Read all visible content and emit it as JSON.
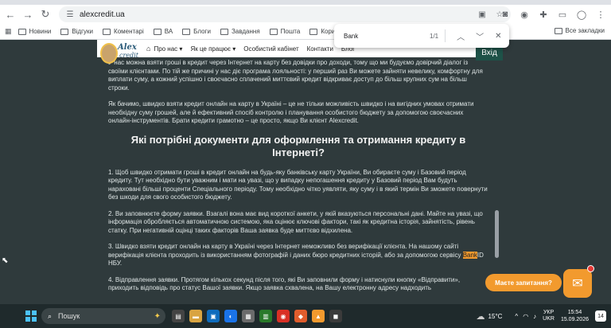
{
  "browser": {
    "url": "alexcredit.ua",
    "find": {
      "query": "Bank",
      "count": "1/1"
    }
  },
  "bookmarks": {
    "items": [
      "Новини",
      "Відгуки",
      "Коментарі",
      "ВА",
      "Блоги",
      "Завдання",
      "Пошта",
      "Корисні"
    ],
    "all_label": "Все закладки"
  },
  "site": {
    "logo_top": "Alex",
    "logo_bottom": "credit",
    "nav": [
      "Про нас",
      "Як це працює",
      "Особистий кабінет",
      "Контакти",
      "Блог"
    ],
    "login": "Вхід"
  },
  "content": {
    "p1": "У нас можна взяти гроші в кредит через Інтернет на карту без довідки про доходи, тому що ми будуємо довірчий діалог із своїми клієнтами. По тій же причині у нас діє програма лояльності: у перший раз Ви можете зайняти невелику, комфортну для виплати суму, а кожний успішно і своєчасно сплачений миттєвий кредит відкриває доступ до більш крупних сум на більш строки.",
    "p2": "Як бачимо, швидко взяти кредит онлайн на карту в Україні – це не тільки можливість швидко і на вигідних умовах отримати необхідну суму грошей, але й ефективний спосіб контролю і планування особистого бюджету за допомогою своєчасних онлайн-інструментів. Брати кредити грамотно – це просто, якщо Ви клієнт Alexcredit.",
    "heading": "Які потрібні документи для оформлення та отримання кредиту в Інтернеті?",
    "s1": "1. Щоб швидко отримати гроші в кредит онлайн на будь-яку банківську карту України, Ви обираєте суму і Базовий період кредиту. Тут необхідно бути уважним і мати на увазі, що у випадку непогашення кредиту у Базовий період Вам будуть нараховані більші проценти Спеціального періоду. Тому необхідно чітко уявляти, яку суму і в який термін Ви зможете повернути без шкоди для свого особистого бюджету.",
    "s2": "2. Ви заповнюєте форму заявки. Взагалі вона має вид короткої анкети, у якій вказуються персональні дані. Майте на увазі, що інформація обробляється автоматичною системою, яка оцінює ключові фактори, такі як кредитна історія, зайнятість, рівень статку. При негативній оцінці таких факторів Ваша заявка буде миттєво відхилена.",
    "s3_before": "3. Швидко взяти кредит онлайн на карту в Україні через Інтернет неможливо без верифікації клієнта. На нашому сайті верифікація клієнта проходить із використанням фотографій і даних бюро кредитних історій, або за допомогою сервісу ",
    "s3_highlight": "Bank",
    "s3_after": "ID НБУ.",
    "s4": "4. Відправлення заявки. Протягом кількох секунд після того, які Ви заповнили форму і натиснули кнопку «Відправити», приходить відповідь про статус Вашої заявки. Якщо заявка схвалена, на Вашу електронну адресу надходить"
  },
  "chat": {
    "bubble": "Маєте запитання?"
  },
  "taskbar": {
    "search_placeholder": "Пошук",
    "weather": "15°C",
    "lang_top": "УКР",
    "lang_bottom": "UKR",
    "time": "15:54",
    "date": "15.09.2026",
    "notif_count": "14"
  },
  "colors": {
    "accent": "#f29a2e",
    "login_bg": "#1e5248",
    "page_bg": "#2f3a3c"
  }
}
